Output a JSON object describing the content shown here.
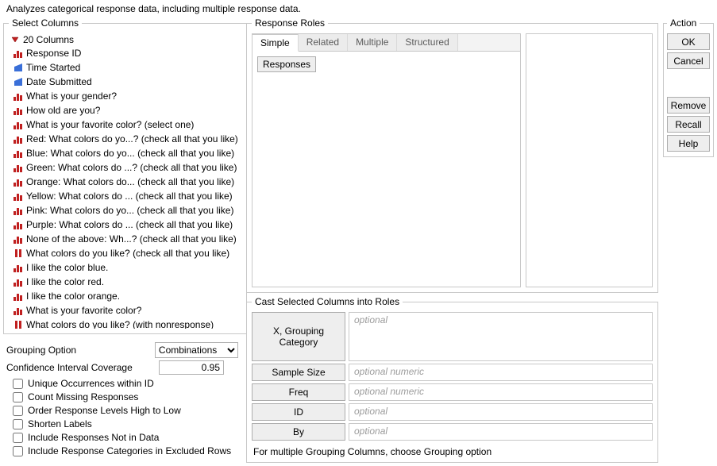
{
  "header": "Analyzes categorical response data, including multiple response data.",
  "select_columns": {
    "title": "Select Columns",
    "summary": "20 Columns",
    "items": [
      {
        "kind": "nominal",
        "label": "Response ID"
      },
      {
        "kind": "continuous",
        "label": "Time Started"
      },
      {
        "kind": "continuous",
        "label": "Date Submitted"
      },
      {
        "kind": "nominal",
        "label": "What is your gender?"
      },
      {
        "kind": "nominal",
        "label": "How old are you?"
      },
      {
        "kind": "nominal",
        "label": "What is your favorite color? (select one)"
      },
      {
        "kind": "nominal",
        "label": "Red: What colors do yo...? (check all that you like)"
      },
      {
        "kind": "nominal",
        "label": "Blue: What colors do yo... (check all that you like)"
      },
      {
        "kind": "nominal",
        "label": "Green: What colors do ...? (check all that you like)"
      },
      {
        "kind": "nominal",
        "label": "Orange: What colors do... (check all that you like)"
      },
      {
        "kind": "nominal",
        "label": "Yellow: What colors do ... (check all that you like)"
      },
      {
        "kind": "nominal",
        "label": "Pink: What colors do yo... (check all that you like)"
      },
      {
        "kind": "nominal",
        "label": "Purple: What colors do ... (check all that you like)"
      },
      {
        "kind": "nominal",
        "label": "None of the above: Wh...? (check all that you like)"
      },
      {
        "kind": "mresp",
        "label": "What colors do you like? (check all that you like)"
      },
      {
        "kind": "nominal",
        "label": "I like the color blue."
      },
      {
        "kind": "nominal",
        "label": "I like the color red."
      },
      {
        "kind": "nominal",
        "label": "I like the color orange."
      },
      {
        "kind": "nominal",
        "label": "What is your favorite color?"
      },
      {
        "kind": "mresp",
        "label": "What colors do you like? (with nonresponse)"
      }
    ]
  },
  "grouping": {
    "option_label": "Grouping Option",
    "option_value": "Combinations",
    "ci_label": "Confidence Interval Coverage",
    "ci_value": "0.95",
    "checks": [
      "Unique Occurrences within ID",
      "Count Missing Responses",
      "Order Response Levels High to Low",
      "Shorten Labels",
      "Include Responses Not in Data",
      "Include Response Categories in Excluded Rows"
    ]
  },
  "response_roles": {
    "title": "Response Roles",
    "tabs": [
      "Simple",
      "Related",
      "Multiple",
      "Structured"
    ],
    "active_tab": 0,
    "simple_button": "Responses"
  },
  "cast": {
    "title": "Cast Selected Columns into Roles",
    "rows": [
      {
        "btn": "X, Grouping Category",
        "ph": "optional",
        "tall": true
      },
      {
        "btn": "Sample Size",
        "ph": "optional numeric",
        "tall": false
      },
      {
        "btn": "Freq",
        "ph": "optional numeric",
        "tall": false
      },
      {
        "btn": "ID",
        "ph": "optional",
        "tall": false
      },
      {
        "btn": "By",
        "ph": "optional",
        "tall": false
      }
    ],
    "footnote": "For multiple Grouping Columns, choose Grouping option"
  },
  "action": {
    "title": "Action",
    "group1": [
      "OK",
      "Cancel"
    ],
    "group2": [
      "Remove",
      "Recall",
      "Help"
    ]
  }
}
